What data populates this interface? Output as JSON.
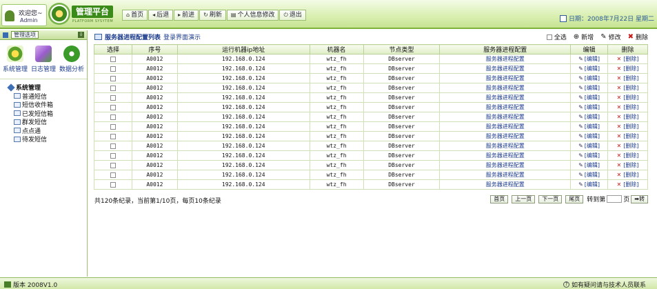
{
  "header": {
    "welcome": "欢迎您~",
    "user": "Admin",
    "logo_title": "管理平台",
    "logo_sub": "PLATFORM SYSYTEM",
    "nav": [
      {
        "label": "首页",
        "icon": "home-icon"
      },
      {
        "label": "后退",
        "icon": "back-arrow-icon"
      },
      {
        "label": "前进",
        "icon": "forward-arrow-icon"
      },
      {
        "label": "刷新",
        "icon": "refresh-icon"
      },
      {
        "label": "个人信息修改",
        "icon": "profile-icon"
      },
      {
        "label": "退出",
        "icon": "power-icon"
      }
    ],
    "date": "日期：2008年7月22日 星期二"
  },
  "sidebar": {
    "title": "管理选项",
    "shortcuts": [
      {
        "label": "系统管理",
        "icon": "gear-icon",
        "color": "#5aa02a"
      },
      {
        "label": "日志管理",
        "icon": "log-icon",
        "color": "#9b5ccf"
      },
      {
        "label": "数据分析",
        "icon": "analysis-icon",
        "color": "#3a9a2a"
      }
    ],
    "group": "系统管理",
    "items": [
      "普通短信",
      "短信收件箱",
      "已发短信箱",
      "群发短信",
      "点点通",
      "待发短信"
    ]
  },
  "content": {
    "title": "服务器进程配置列表",
    "subtitle": "登录界面演示",
    "tools": {
      "select_all": "全选",
      "add": "新增",
      "edit": "修改",
      "delete": "删除"
    },
    "columns": [
      "选择",
      "序号",
      "运行机器ip地址",
      "机器名",
      "节点类型",
      "服务器进程配置",
      "编辑",
      "删除"
    ],
    "rows": [
      {
        "id": "A0012",
        "ip": "192.168.0.124",
        "machine": "wtz_fh",
        "node": "DBserver",
        "config": "服务器进程配置",
        "edit": "[编辑]",
        "delete": "[删除]"
      },
      {
        "id": "A0012",
        "ip": "192.168.0.124",
        "machine": "wtz_fh",
        "node": "DBserver",
        "config": "服务器进程配置",
        "edit": "[编辑]",
        "delete": "[删除]"
      },
      {
        "id": "A0012",
        "ip": "192.168.0.124",
        "machine": "wtz_fh",
        "node": "DBserver",
        "config": "服务器进程配置",
        "edit": "[编辑]",
        "delete": "[删除]"
      },
      {
        "id": "A0012",
        "ip": "192.168.0.124",
        "machine": "wtz_fh",
        "node": "DBserver",
        "config": "服务器进程配置",
        "edit": "[编辑]",
        "delete": "[删除]"
      },
      {
        "id": "A0012",
        "ip": "192.168.0.124",
        "machine": "wtz_fh",
        "node": "DBserver",
        "config": "服务器进程配置",
        "edit": "[编辑]",
        "delete": "[删除]"
      },
      {
        "id": "A0012",
        "ip": "192.168.0.124",
        "machine": "wtz_fh",
        "node": "DBserver",
        "config": "服务器进程配置",
        "edit": "[编辑]",
        "delete": "[删除]"
      },
      {
        "id": "A0012",
        "ip": "192.168.0.124",
        "machine": "wtz_fh",
        "node": "DBserver",
        "config": "服务器进程配置",
        "edit": "[编辑]",
        "delete": "[删除]"
      },
      {
        "id": "A0012",
        "ip": "192.168.0.124",
        "machine": "wtz_fh",
        "node": "DBserver",
        "config": "服务器进程配置",
        "edit": "[编辑]",
        "delete": "[删除]"
      },
      {
        "id": "A0012",
        "ip": "192.168.0.124",
        "machine": "wtz_fh",
        "node": "DBserver",
        "config": "服务器进程配置",
        "edit": "[编辑]",
        "delete": "[删除]"
      },
      {
        "id": "A0012",
        "ip": "192.168.0.124",
        "machine": "wtz_fh",
        "node": "DBserver",
        "config": "服务器进程配置",
        "edit": "[编辑]",
        "delete": "[删除]"
      },
      {
        "id": "A0012",
        "ip": "192.168.0.124",
        "machine": "wtz_fh",
        "node": "DBserver",
        "config": "服务器进程配置",
        "edit": "[编辑]",
        "delete": "[删除]"
      },
      {
        "id": "A0012",
        "ip": "192.168.0.124",
        "machine": "wtz_fh",
        "node": "DBserver",
        "config": "服务器进程配置",
        "edit": "[编辑]",
        "delete": "[删除]"
      },
      {
        "id": "A0012",
        "ip": "192.168.0.124",
        "machine": "wtz_fh",
        "node": "DBserver",
        "config": "服务器进程配置",
        "edit": "[编辑]",
        "delete": "[删除]"
      },
      {
        "id": "A0012",
        "ip": "192.168.0.124",
        "machine": "wtz_fh",
        "node": "DBserver",
        "config": "服务器进程配置",
        "edit": "[编辑]",
        "delete": "[删除]"
      }
    ],
    "summary": "共120条纪录，当前第1/10页，每页10条纪录",
    "pager": {
      "first": "首页",
      "prev": "上一页",
      "next": "下一页",
      "last": "尾页",
      "goto_prefix": "转到第",
      "goto_suffix": "页",
      "go": "转"
    }
  },
  "status": {
    "version": "版本 2008V1.0",
    "help": "如有疑问请与技术人员联系"
  }
}
